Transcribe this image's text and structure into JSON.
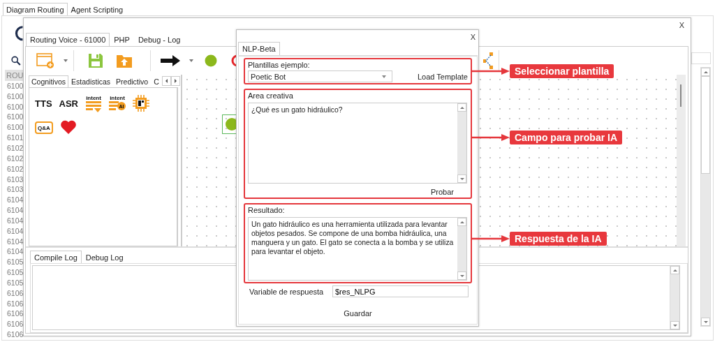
{
  "main_tabs": [
    {
      "label": "Diagram Routing",
      "selected": true
    },
    {
      "label": "Agent Scripting",
      "selected": false
    }
  ],
  "routes": {
    "header": "ROU",
    "rows": [
      "6100",
      "6100",
      "6100",
      "6100",
      "6100",
      "6101",
      "6102",
      "6102",
      "6102",
      "6103",
      "6103",
      "6104",
      "6104",
      "6104",
      "6104",
      "6104",
      "6104",
      "6105",
      "6105",
      "6105",
      "6106",
      "6106",
      "6106",
      "6106",
      "6106"
    ]
  },
  "editor": {
    "close": "X",
    "tabs": [
      {
        "label": "Routing Voice - 61000",
        "selected": true
      },
      {
        "label": "PHP",
        "selected": false
      },
      {
        "label": "Debug - Log",
        "selected": false
      }
    ],
    "palette": {
      "tabs": [
        {
          "label": "Cognitivos",
          "selected": true
        },
        {
          "label": "Estadisticas",
          "selected": false
        },
        {
          "label": "Predictivo",
          "selected": false
        },
        {
          "label": "C",
          "selected": false
        }
      ],
      "items": [
        {
          "kind": "text",
          "label": "TTS"
        },
        {
          "kind": "text",
          "label": "ASR"
        },
        {
          "kind": "intent",
          "label": "intent"
        },
        {
          "kind": "intent_ai",
          "label": "intent",
          "badge": "AI"
        },
        {
          "kind": "chip"
        },
        {
          "kind": "qa",
          "label": "Q&A"
        },
        {
          "kind": "heart"
        }
      ]
    },
    "log_tabs": [
      {
        "label": "Compile Log",
        "selected": true
      },
      {
        "label": "Debug Log",
        "selected": false
      }
    ]
  },
  "dialog": {
    "close": "X",
    "tab": "NLP-Beta",
    "template": {
      "label": "Plantillas ejemplo:",
      "value": "Poetic Bot",
      "button": "Load Template",
      "callout": "Seleccionar plantilla"
    },
    "prompt": {
      "label": "Area creativa",
      "value": "¿Qué es un gato hidráulico?",
      "button": "Probar",
      "callout": "Campo para probar IA"
    },
    "result": {
      "label": "Resultado:",
      "value": "Un gato hidráulico es una herramienta utilizada para levantar objetos pesados. Se compone de una bomba hidráulica, una manguera y un gato. El gato se conecta a la bomba y se utiliza para levantar el objeto.",
      "callout": "Respuesta de la IA"
    },
    "variable": {
      "label": "Variable de respuesta",
      "value": "$res_NLPG"
    },
    "save": "Guardar"
  }
}
